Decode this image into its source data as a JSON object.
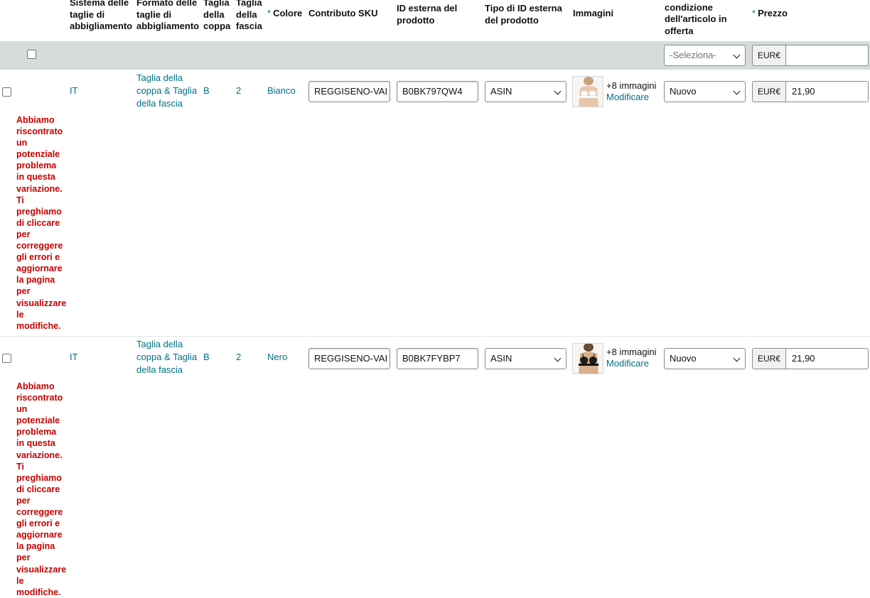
{
  "headers": {
    "size_system": "Sistema delle taglie di abbigliamento",
    "size_format": "Formato delle taglie di abbigliamento",
    "cup_size": "Taglia della coppa",
    "band_size": "Taglia della fascia",
    "color_required": "*",
    "color": "Colore",
    "sku": "Contributo SKU",
    "external_id": "ID esterna del prodotto",
    "external_id_type": "Tipo di ID esterna del prodotto",
    "images": "Immagini",
    "condition": "condizione dell'articolo in offerta",
    "price_required": "*",
    "price": "Prezzo"
  },
  "filter": {
    "condition_placeholder": "-Seleziona-",
    "currency": "EUR€",
    "price_value": ""
  },
  "rows": [
    {
      "size_system": "IT",
      "size_format": "Taglia della coppa & Taglia della fascia",
      "cup": "B",
      "band": "2",
      "color": "Bianco",
      "sku": "REGGISENO-VAI",
      "external_id": "B0BK797QW4",
      "id_type": "ASIN",
      "image_icon": "white-bra-photo",
      "images_more": "+8 immagini",
      "images_edit": "Modificare",
      "condition": "Nuovo",
      "currency": "EUR€",
      "price": "21,90",
      "error": "Abbiamo riscontrato un potenziale problema in questa variazione. Ti preghiamo di cliccare per correggere gli errori e aggiornare la pagina per visualizzare le modifiche."
    },
    {
      "size_system": "IT",
      "size_format": "Taglia della coppa & Taglia della fascia",
      "cup": "B",
      "band": "2",
      "color": "Nero",
      "sku": "REGGISENO-VAI",
      "external_id": "B0BK7FYBP7",
      "id_type": "ASIN",
      "image_icon": "black-bra-photo",
      "images_more": "+8 immagini",
      "images_edit": "Modificare",
      "condition": "Nuovo",
      "currency": "EUR€",
      "price": "21,90",
      "error": "Abbiamo riscontrato un potenziale problema in questa variazione. Ti preghiamo di cliccare per correggere gli errori e aggiornare la pagina per visualizzare le modifiche."
    }
  ],
  "colors": {
    "link": "#007185",
    "error": "#c40000",
    "filter_bar": "#d5dbdb"
  }
}
